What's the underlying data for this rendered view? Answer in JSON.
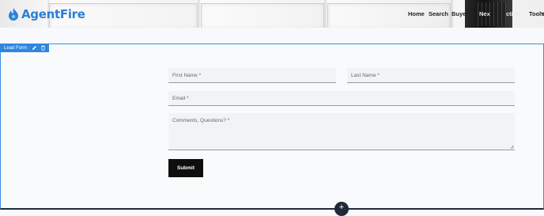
{
  "header": {
    "logo_text": "AgentFire",
    "nav": {
      "home": "Home",
      "search": "Search",
      "buyers": "Buye",
      "nex": "Nex",
      "ction": "ction",
      "tools": "Tools"
    }
  },
  "module": {
    "label": "Lead Form",
    "edit_icon": "pencil-icon",
    "delete_icon": "trash-icon",
    "accent": "#2f86e0"
  },
  "form": {
    "first_name_placeholder": "First Name *",
    "last_name_placeholder": "Last Name *",
    "email_placeholder": "Email *",
    "comments_placeholder": "Comments, Questions? *",
    "submit_label": "Submit"
  },
  "add_section": {
    "icon": "plus-icon",
    "label": "+"
  }
}
